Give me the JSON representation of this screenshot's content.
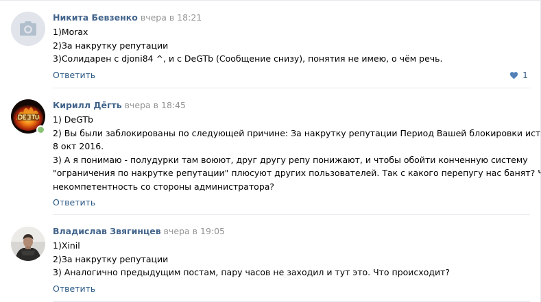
{
  "colors": {
    "author": "#42648b",
    "link": "#2a5885",
    "date": "#939393",
    "divider": "#e7e8ec",
    "online": "#8ac176",
    "avatar_placeholder": "#e1e5eb"
  },
  "comments": [
    {
      "author": "Никита Бевзенко",
      "date": "вчера в 18:21",
      "avatar_icon": "camera-icon",
      "lines": [
        "1)Morax",
        "2)За накрутку репутации",
        "3)Солидарен с djoni84 ^, и с DeGTb (Сообщение снизу), понятия не имею, о чём речь."
      ],
      "reply_label": "Ответить",
      "likes_count": "1",
      "likes_icon": "heart-icon"
    },
    {
      "author": "Кирилл Дёгть",
      "date": "вчера в 18:45",
      "online": true,
      "lines": [
        "1) DeGTb",
        "2) Вы были заблокированы по следующей причине: За накрутку репутации Период Вашей блокировки истекает",
        "8 окт 2016.",
        "3) А я понимаю - полудурки там воюют, друг другу репу понижают, и чтобы обойти конченную систему",
        "\"ограничения по накрутке репутации\" плюсуют других пользователей. Так с какого перепугу нас банят? Что за",
        "некомпетентность со стороны администратора?"
      ],
      "reply_label": "Ответить"
    },
    {
      "author": "Владислав Звягинцев",
      "date": "вчера в 19:05",
      "lines": [
        "1)Xinil",
        "2)За накрутку репутации",
        "3) Аналогично предыдущим постам, пару часов не заходил и тут это. Что происходит?"
      ],
      "reply_label": "Ответить"
    }
  ]
}
